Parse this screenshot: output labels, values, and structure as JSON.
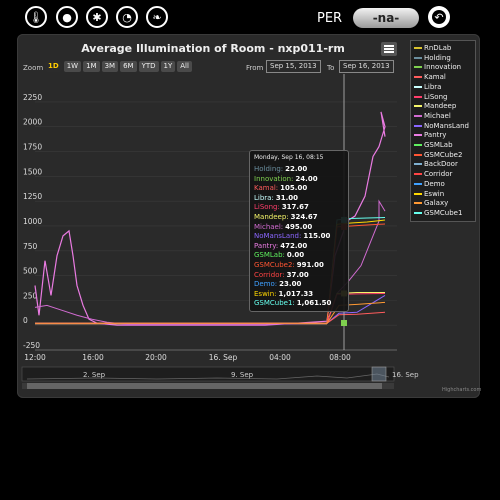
{
  "toolbar": {
    "icons": [
      "thermometer-icon",
      "droplet-icon",
      "molecules-icon",
      "gauge-icon",
      "leaf-icon"
    ],
    "icon_glyphs": [
      "🌡",
      "●",
      "✱",
      "◔",
      "❧"
    ],
    "per_label": "PER",
    "per_value": "-na-",
    "undo_glyph": "↶"
  },
  "chart": {
    "title": "Average Illumination of Room - nxp011-rm",
    "zoom_label": "Zoom",
    "zoom_buttons": [
      "1D",
      "1W",
      "1M",
      "3M",
      "6M",
      "YTD",
      "1Y",
      "All"
    ],
    "zoom_selected": "1D",
    "from_label": "From",
    "from_value": "Sep 15, 2013",
    "to_label": "To",
    "to_value": "Sep 16, 2013",
    "credits": "Highcharts.com",
    "navigator_labels": [
      "2. Sep",
      "9. Sep",
      "16. Sep"
    ]
  },
  "tooltip": {
    "title": "Monday, Sep 16, 08:15",
    "rows": [
      {
        "name": "Holding",
        "value": "22.00",
        "color": "#6b8e9e"
      },
      {
        "name": "Innovation",
        "value": "24.00",
        "color": "#7fd04f"
      },
      {
        "name": "Kamal",
        "value": "105.00",
        "color": "#ff5c5c"
      },
      {
        "name": "Libra",
        "value": "31.00",
        "color": "#c9ffff"
      },
      {
        "name": "LiSong",
        "value": "317.67",
        "color": "#ff3e6b"
      },
      {
        "name": "Mandeep",
        "value": "324.67",
        "color": "#f5f56a"
      },
      {
        "name": "Michael",
        "value": "495.00",
        "color": "#d16bd1"
      },
      {
        "name": "NoMansLand",
        "value": "115.00",
        "color": "#8a66ff"
      },
      {
        "name": "Pantry",
        "value": "472.00",
        "color": "#ea7be2"
      },
      {
        "name": "GSMLab",
        "value": "0.00",
        "color": "#5ef05e"
      },
      {
        "name": "GSMCube2",
        "value": "991.00",
        "color": "#ff5533"
      },
      {
        "name": "Corridor",
        "value": "37.00",
        "color": "#ff4444"
      },
      {
        "name": "Demo",
        "value": "23.00",
        "color": "#3fa0ff"
      },
      {
        "name": "Eswin",
        "value": "1,017.33",
        "color": "#ffd700"
      },
      {
        "name": "GSMCube1",
        "value": "1,061.50",
        "color": "#66ffee"
      }
    ]
  },
  "chart_data": {
    "type": "line",
    "title": "Average Illumination of Room - nxp011-rm",
    "x_ticks": [
      "12:00",
      "16:00",
      "20:00",
      "16. Sep",
      "04:00",
      "08:00"
    ],
    "y_ticks": [
      -250,
      0,
      250,
      500,
      750,
      1000,
      1250,
      1500,
      1750,
      2000,
      2250
    ],
    "ylim": [
      -250,
      2350
    ],
    "legend_position": "right",
    "crosshair_x": "08:15",
    "series": [
      {
        "name": "RnDLab",
        "color": "#d9c22e"
      },
      {
        "name": "Holding",
        "color": "#6b8e9e"
      },
      {
        "name": "Innovation",
        "color": "#7fd04f"
      },
      {
        "name": "Kamal",
        "color": "#ff5c5c"
      },
      {
        "name": "Libra",
        "color": "#c9ffff"
      },
      {
        "name": "LiSong",
        "color": "#ff3e6b"
      },
      {
        "name": "Mandeep",
        "color": "#f5f56a"
      },
      {
        "name": "Michael",
        "color": "#d16bd1"
      },
      {
        "name": "NoMansLand",
        "color": "#8a66ff"
      },
      {
        "name": "Pantry",
        "color": "#ea7be2"
      },
      {
        "name": "GSMLab",
        "color": "#5ef05e"
      },
      {
        "name": "GSMCube2",
        "color": "#ff5533"
      },
      {
        "name": "BackDoor",
        "color": "#7fb0d0"
      },
      {
        "name": "Corridor",
        "color": "#ff4444"
      },
      {
        "name": "Demo",
        "color": "#3fa0ff"
      },
      {
        "name": "Eswin",
        "color": "#ffd700"
      },
      {
        "name": "Galaxy",
        "color": "#ff9933"
      },
      {
        "name": "GSMCube1",
        "color": "#66ffee"
      }
    ]
  }
}
